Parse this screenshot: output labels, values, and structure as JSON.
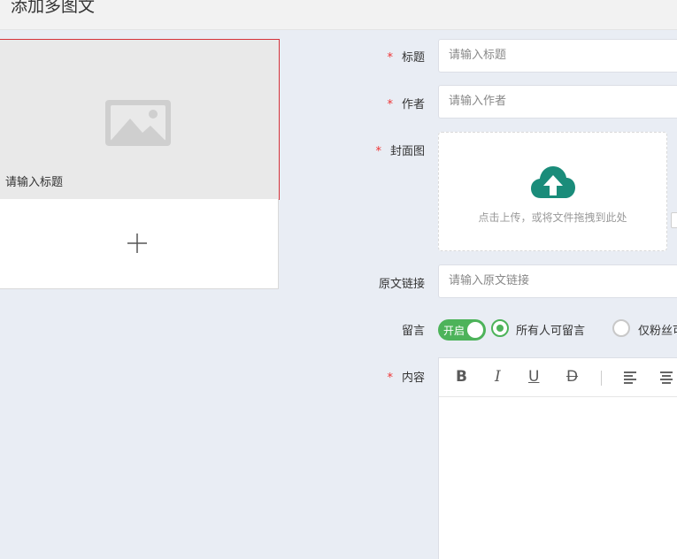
{
  "page": {
    "title": "添加多图文"
  },
  "article_list": {
    "card_title": "请输入标题",
    "image_icon": "image-placeholder-icon",
    "add_icon": "plus-icon"
  },
  "form": {
    "title_label": "标题",
    "title_placeholder": "请输入标题",
    "author_label": "作者",
    "author_placeholder": "请输入作者",
    "cover_label": "封面图",
    "upload_hint": "点击上传，或将文件拖拽到此处",
    "upload_icon": "cloud-upload-icon",
    "link_label": "原文链接",
    "link_placeholder": "请输入原文链接",
    "comment_label": "留言",
    "comment_toggle_text": "开启",
    "comment_toggle_on": true,
    "comment_option_all": "所有人可留言",
    "comment_option_fans": "仅粉丝可留言",
    "content_label": "内容",
    "required_mark": "*"
  },
  "editor": {
    "bold": "B",
    "italic": "I",
    "underline": "U",
    "strike": "D"
  },
  "colors": {
    "accent_green": "#4db35a",
    "cloud_teal": "#1a8c7a",
    "required_red": "#e33333",
    "selected_border": "#d5323a"
  }
}
